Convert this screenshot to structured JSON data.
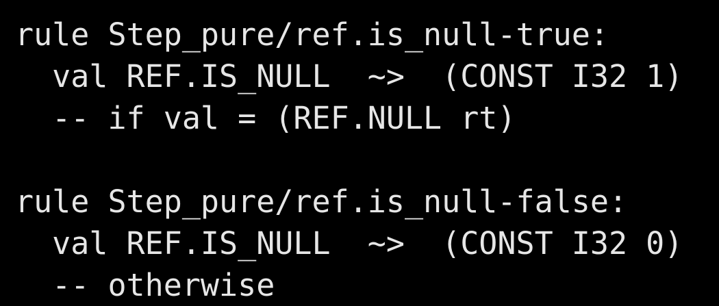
{
  "colors": {
    "background": "#000000",
    "text": "#e6e6e6"
  },
  "code": {
    "lines": [
      "rule Step_pure/ref.is_null-true:",
      "  val REF.IS_NULL  ~>  (CONST I32 1)",
      "  -- if val = (REF.NULL rt)",
      "",
      "rule Step_pure/ref.is_null-false:",
      "  val REF.IS_NULL  ~>  (CONST I32 0)",
      "  -- otherwise"
    ]
  }
}
